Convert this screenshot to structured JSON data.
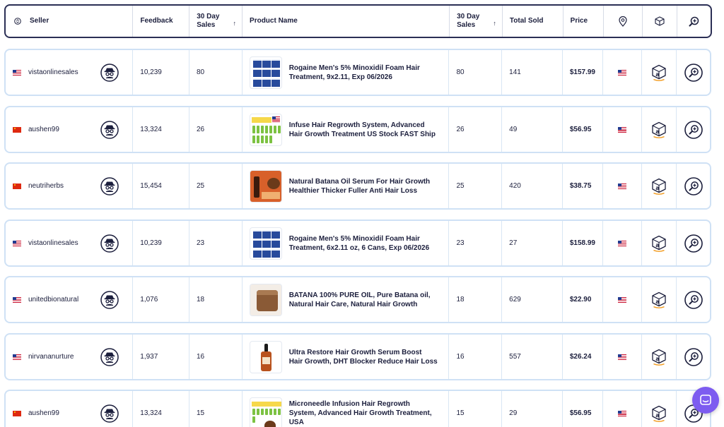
{
  "header": {
    "seller": "Seller",
    "feedback": "Feedback",
    "sales30_line1": "30 Day",
    "sales30_line2": "Sales",
    "product": "Product Name",
    "sales30b_line1": "30 Day",
    "sales30b_line2": "Sales",
    "total_sold": "Total Sold",
    "price": "Price",
    "sort_glyph": "↑"
  },
  "icons": {
    "seller_sort": "sort-icon",
    "location": "location-pin-icon",
    "package": "package-box-icon",
    "search": "search-plus-icon",
    "spy": "spy-icon",
    "amazon": "amazon-box-icon",
    "chat": "chat-icon"
  },
  "colors": {
    "primary": "#2b2f55",
    "row_border": "#cfe1f5",
    "chat": "#7d5cf0"
  },
  "rows": [
    {
      "flag": "us",
      "seller": "vistaonlinesales",
      "feedback": "10,239",
      "sales30": "80",
      "product_line1": "Rogaine Men's 5% Minoxidil Foam Hair",
      "product_line2": "Treatment, 9x2.11, Exp 06/2026",
      "product_line3": "",
      "sales30b": "80",
      "total_sold": "141",
      "price": "$157.99",
      "thumb": "rogaine"
    },
    {
      "flag": "cn",
      "seller": "aushen99",
      "feedback": "13,324",
      "sales30": "26",
      "product_line1": "Infuse Hair Regrowth System, Advanced",
      "product_line2": "Hair Growth Treatment US Stock FAST Ship",
      "product_line3": "",
      "sales30b": "26",
      "total_sold": "49",
      "price": "$56.95",
      "thumb": "vials"
    },
    {
      "flag": "cn",
      "seller": "neutriherbs",
      "feedback": "15,454",
      "sales30": "25",
      "product_line1": "Natural Batana Oil Serum For Hair Growth",
      "product_line2": "Healthier Thicker Fuller Anti Hair Loss",
      "product_line3": "",
      "sales30b": "25",
      "total_sold": "420",
      "price": "$38.75",
      "thumb": "batana"
    },
    {
      "flag": "us",
      "seller": "vistaonlinesales",
      "feedback": "10,239",
      "sales30": "23",
      "product_line1": "Rogaine Men's 5% Minoxidil Foam Hair",
      "product_line2": "Treatment, 6x2.11 oz, 6 Cans, Exp 06/2026",
      "product_line3": "",
      "sales30b": "23",
      "total_sold": "27",
      "price": "$158.99",
      "thumb": "rogaine"
    },
    {
      "flag": "us",
      "seller": "unitedbionatural",
      "feedback": "1,076",
      "sales30": "18",
      "product_line1": "BATANA 100% PURE OIL, Pure Batana oil,",
      "product_line2": "Natural Hair Care, Natural Hair Growth",
      "product_line3": "",
      "sales30b": "18",
      "total_sold": "629",
      "price": "$22.90",
      "thumb": "jar"
    },
    {
      "flag": "us",
      "seller": "nirvananurture",
      "feedback": "1,937",
      "sales30": "16",
      "product_line1": "Ultra Restore Hair Growth Serum Boost",
      "product_line2": "Hair Growth, DHT Blocker Reduce Hair Loss",
      "product_line3": "",
      "sales30b": "16",
      "total_sold": "557",
      "price": "$26.24",
      "thumb": "dropper"
    },
    {
      "flag": "cn",
      "seller": "aushen99",
      "feedback": "13,324",
      "sales30": "15",
      "product_line1": "Microneedle Infusion Hair Regrowth",
      "product_line2": "System, Advanced Hair Growth Treatment,",
      "product_line3": "USA",
      "sales30b": "15",
      "total_sold": "29",
      "price": "$56.95",
      "thumb": "micro"
    }
  ]
}
